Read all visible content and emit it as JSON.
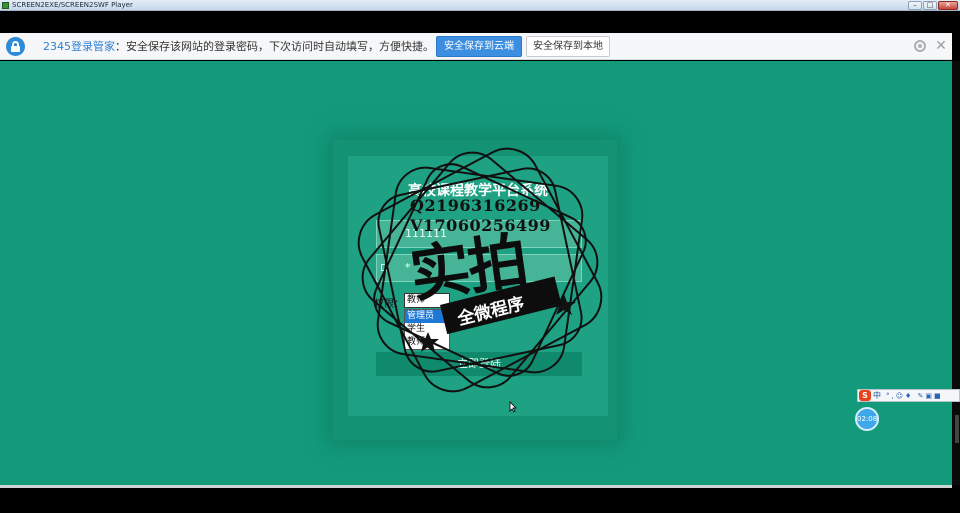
{
  "window": {
    "title": "SCREEN2EXE/SCREEN2SWF Player",
    "min_glyph": "–",
    "max_glyph": "□",
    "close_glyph": "✕"
  },
  "password_bar": {
    "brand": "2345登录管家",
    "message": "：安全保存该网站的登录密码，下次访问时自动填写，方便快捷。",
    "save_cloud": "安全保存到云端",
    "save_local": "安全保存到本地",
    "close_glyph": "✕",
    "icons": [
      "lock-icon",
      "gear-icon",
      "close-icon"
    ]
  },
  "login": {
    "title": "高校课程教学平台系统",
    "username_value": "111111",
    "password_value": "*",
    "role_label": "权限：",
    "role_selected": "教师",
    "role_options": [
      "管理员",
      "学生",
      "教师"
    ],
    "submit_label": "立即登陆"
  },
  "watermark": {
    "line1": "Q2196316269",
    "line2": "V17060256499",
    "big": "实拍",
    "ribbon": "全微程序"
  },
  "taskbar": {
    "ime_logo": "S",
    "ime_mode": "中",
    "ime_icons": "°,☺♦ ✎▣■",
    "clock_time": "02:08"
  },
  "colors": {
    "stage": "#139a7b",
    "accent_blue": "#3b8ee0",
    "brand_blue": "#2f7fd3"
  }
}
